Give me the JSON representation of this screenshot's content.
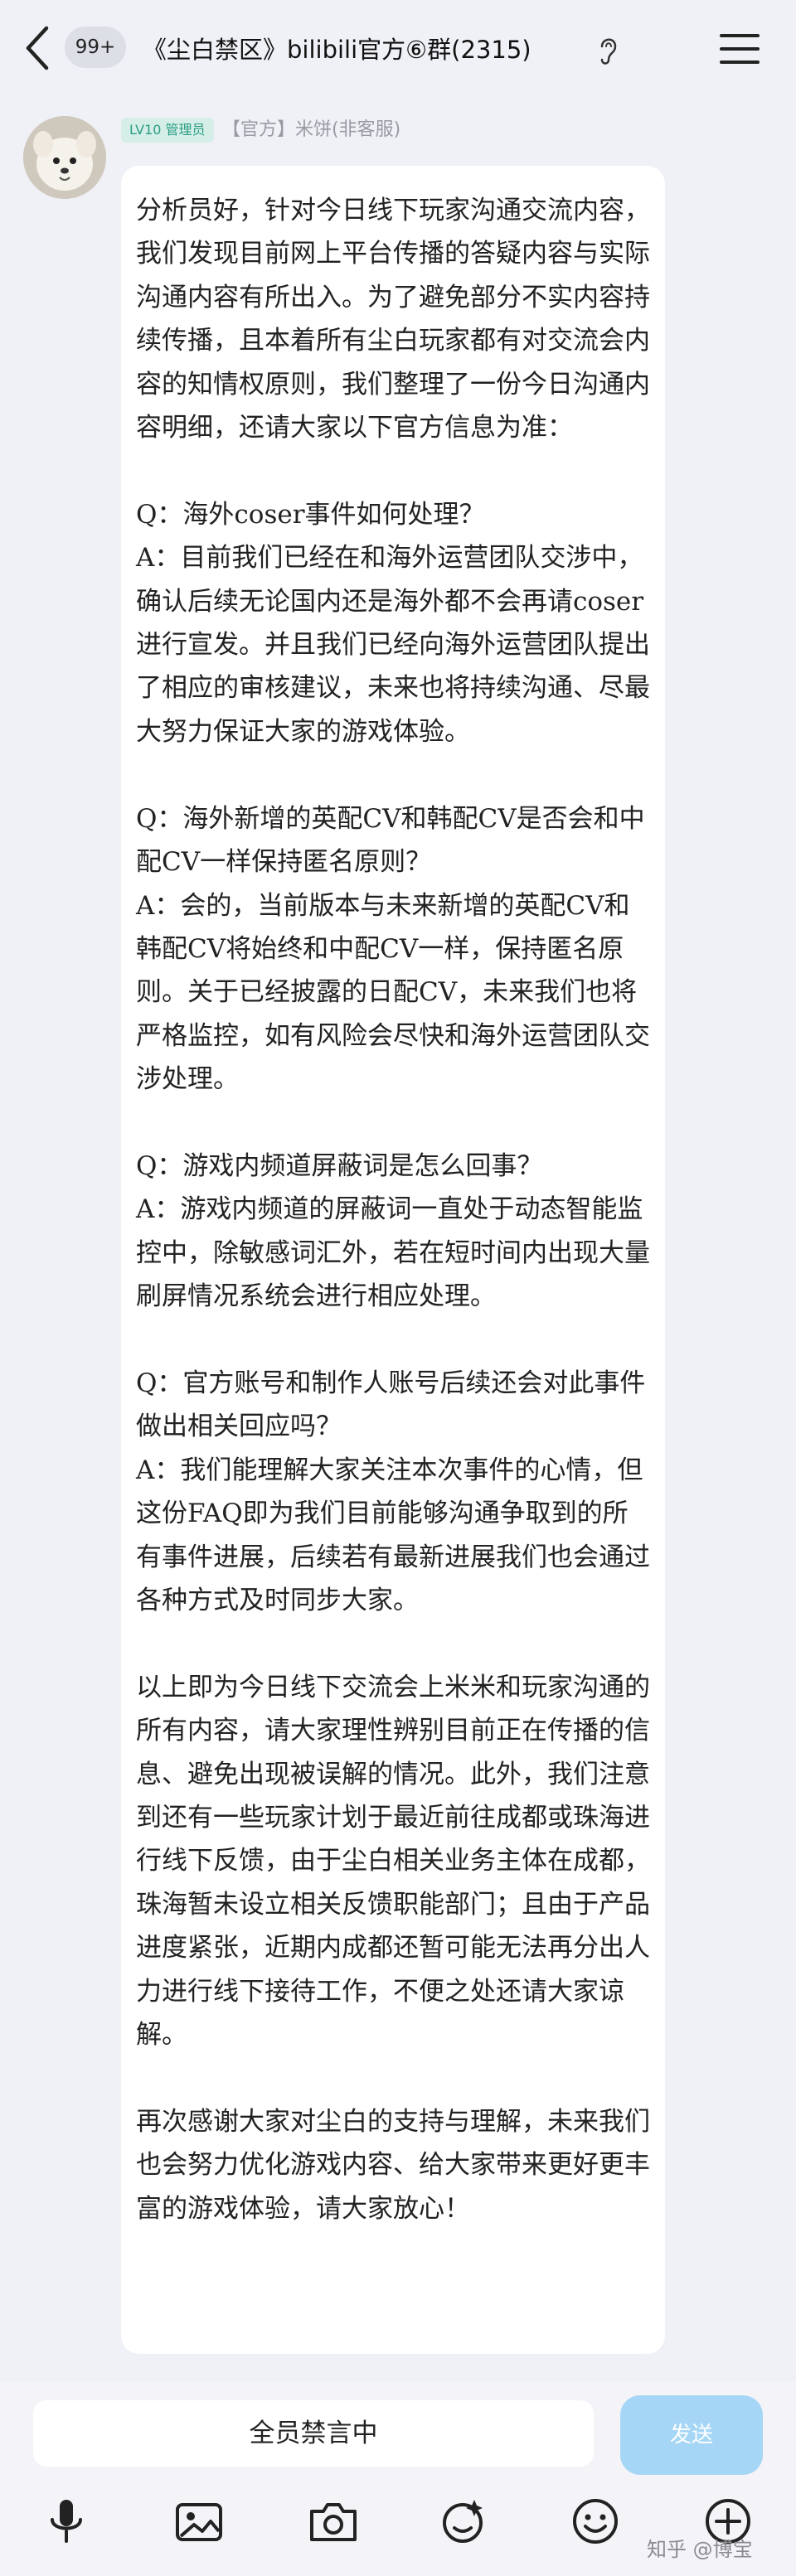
{
  "header": {
    "back_icon": "chevron-left-icon",
    "unread_badge": "99+",
    "title": "《尘白禁区》bilibili官方⑥群(2315)",
    "ear_icon": "ear-icon",
    "menu_icon": "hamburger-menu-icon"
  },
  "message": {
    "level_badge": "LV10 管理员",
    "sender": "【官方】米饼(非客服)",
    "text": "分析员好，针对今日线下玩家沟通交流内容，我们发现目前网上平台传播的答疑内容与实际沟通内容有所出入。为了避免部分不实内容持续传播，且本着所有尘白玩家都有对交流会内容的知情权原则，我们整理了一份今日沟通内容明细，还请大家以下官方信息为准：\n\nQ：海外coser事件如何处理？\nA：目前我们已经在和海外运营团队交涉中，确认后续无论国内还是海外都不会再请coser进行宣发。并且我们已经向海外运营团队提出了相应的审核建议，未来也将持续沟通、尽最大努力保证大家的游戏体验。\n\nQ：海外新增的英配CV和韩配CV是否会和中配CV一样保持匿名原则？\nA：会的，当前版本与未来新增的英配CV和韩配CV将始终和中配CV一样，保持匿名原则。关于已经披露的日配CV，未来我们也将严格监控，如有风险会尽快和海外运营团队交涉处理。\n\nQ：游戏内频道屏蔽词是怎么回事？\nA：游戏内频道的屏蔽词一直处于动态智能监控中，除敏感词汇外，若在短时间内出现大量刷屏情况系统会进行相应处理。\n\nQ：官方账号和制作人账号后续还会对此事件做出相关回应吗？\nA：我们能理解大家关注本次事件的心情，但这份FAQ即为我们目前能够沟通争取到的所有事件进展，后续若有最新进展我们也会通过各种方式及时同步大家。\n\n以上即为今日线下交流会上米米和玩家沟通的所有内容，请大家理性辨别目前正在传播的信息、避免出现被误解的情况。此外，我们注意到还有一些玩家计划于最近前往成都或珠海进行线下反馈，由于尘白相关业务主体在成都，珠海暂未设立相关反馈职能部门；且由于产品进度紧张，近期内成都还暂可能无法再分出人力进行线下接待工作，不便之处还请大家谅解。\n\n再次感谢大家对尘白的支持与理解，未来我们也会努力优化游戏内容、给大家带来更好更丰富的游戏体验，请大家放心！"
  },
  "bottom": {
    "muted_text": "全员禁言中",
    "send_label": "发送",
    "tools": [
      "microphone-icon",
      "image-icon",
      "camera-icon",
      "sticker-icon",
      "emoji-icon",
      "plus-icon"
    ]
  },
  "watermark": "知乎 @博宝"
}
